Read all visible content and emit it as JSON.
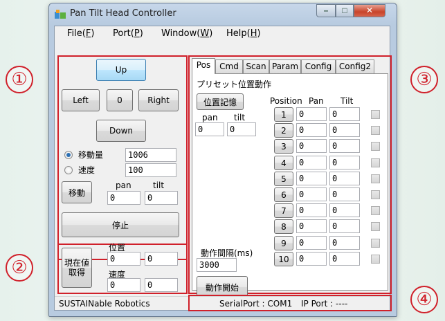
{
  "window": {
    "title": "Pan Tilt Head Controller"
  },
  "menu": [
    {
      "text": "File(",
      "key": "F",
      "end": ")"
    },
    {
      "text": "Port(",
      "key": "P",
      "end": ")"
    },
    {
      "text": "Window(",
      "key": "W",
      "end": ")"
    },
    {
      "text": "Help(",
      "key": "H",
      "end": ")"
    }
  ],
  "callouts": [
    "①",
    "②",
    "③",
    "④"
  ],
  "control": {
    "up": "Up",
    "left": "Left",
    "zero": "0",
    "right": "Right",
    "down": "Down",
    "move_amount_label": "移動量",
    "move_amount_value": "1006",
    "speed_label": "速度",
    "speed_value": "100",
    "move_button": "移動",
    "pan_label": "pan",
    "tilt_label": "tilt",
    "pan_value": "0",
    "tilt_value": "0",
    "stop_button": "停止"
  },
  "current": {
    "get_button": "現在値\n取得",
    "position_label": "位置",
    "pos_pan": "0",
    "pos_tilt": "0",
    "speed_label": "速度",
    "speed_pan": "0",
    "speed_tilt": "0"
  },
  "tabs": [
    "Pos",
    "Cmd",
    "Scan",
    "Param",
    "Config",
    "Config2"
  ],
  "pos_tab": {
    "heading": "プリセット位置動作",
    "remember_button": "位置記憶",
    "pan_label": "pan",
    "tilt_label": "tilt",
    "pan_value": "0",
    "tilt_value": "0",
    "col_position": "Position",
    "col_pan": "Pan",
    "col_tilt": "Tilt",
    "interval_label": "動作間隔(ms)",
    "interval_value": "3000",
    "start_button": "動作開始",
    "presets": [
      {
        "n": "1",
        "pan": "0",
        "tilt": "0"
      },
      {
        "n": "2",
        "pan": "0",
        "tilt": "0"
      },
      {
        "n": "3",
        "pan": "0",
        "tilt": "0"
      },
      {
        "n": "4",
        "pan": "0",
        "tilt": "0"
      },
      {
        "n": "5",
        "pan": "0",
        "tilt": "0"
      },
      {
        "n": "6",
        "pan": "0",
        "tilt": "0"
      },
      {
        "n": "7",
        "pan": "0",
        "tilt": "0"
      },
      {
        "n": "8",
        "pan": "0",
        "tilt": "0"
      },
      {
        "n": "9",
        "pan": "0",
        "tilt": "0"
      },
      {
        "n": "10",
        "pan": "0",
        "tilt": "0"
      }
    ]
  },
  "status": {
    "company": "SUSTAINable Robotics",
    "serial_port": "SerialPort : COM1",
    "ip_port": "IP Port :   ----"
  }
}
